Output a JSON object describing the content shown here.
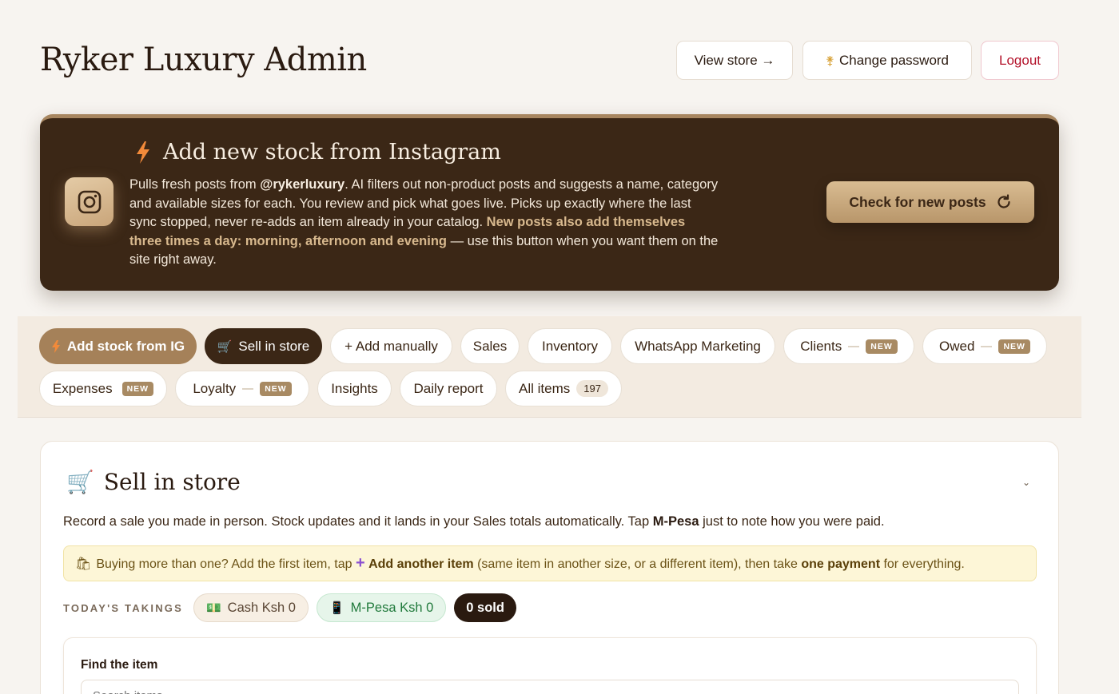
{
  "header": {
    "title": "Ryker Luxury Admin",
    "view_store": "View store →",
    "change_password": "Change password",
    "logout": "Logout"
  },
  "instagram": {
    "title": "Add new stock from Instagram",
    "desc_1": "Pulls fresh posts from ",
    "handle": "@rykerluxury",
    "desc_2": ". AI filters out non-product posts and suggests a name, category and available sizes for each. You review and pick what goes live. Picks up exactly where the last sync stopped, never re-adds an item already in your catalog. ",
    "desc_highlight": "New posts also add themselves three times a day: morning, afternoon and evening",
    "desc_3": " — use this button when you want them on the site right away.",
    "check_button": "Check for new posts"
  },
  "nav": {
    "tabs": [
      {
        "label": "Add stock from IG"
      },
      {
        "label": "Sell in store"
      },
      {
        "label": "+ Add manually"
      },
      {
        "label": "Sales"
      },
      {
        "label": "Inventory"
      },
      {
        "label": "WhatsApp Marketing"
      },
      {
        "label": "Clients",
        "badge": "NEW"
      },
      {
        "label": "Owed",
        "badge": "NEW"
      },
      {
        "label": "Expenses",
        "badge": "NEW"
      },
      {
        "label": "Loyalty",
        "badge": "NEW"
      },
      {
        "label": "Insights"
      },
      {
        "label": "Daily report"
      },
      {
        "label": "All items",
        "count": "197"
      }
    ]
  },
  "sell": {
    "title": "Sell in store",
    "desc_1": "Record a sale you made in person. Stock updates and it lands in your Sales totals automatically. Tap ",
    "desc_bold": "M-Pesa",
    "desc_2": " just to note how you were paid.",
    "tip_1": "Buying more than one? Add the first item, tap ",
    "tip_bold_1": "Add another item",
    "tip_2": " (same item in another size, or a different item), then take ",
    "tip_bold_2": "one payment",
    "tip_3": " for everything.",
    "takings_label": "TODAY'S TAKINGS",
    "cash": "Cash Ksh 0",
    "mpesa": "M-Pesa Ksh 0",
    "sold": "0 sold",
    "find_label": "Find the item",
    "search_placeholder": "Search items..."
  }
}
